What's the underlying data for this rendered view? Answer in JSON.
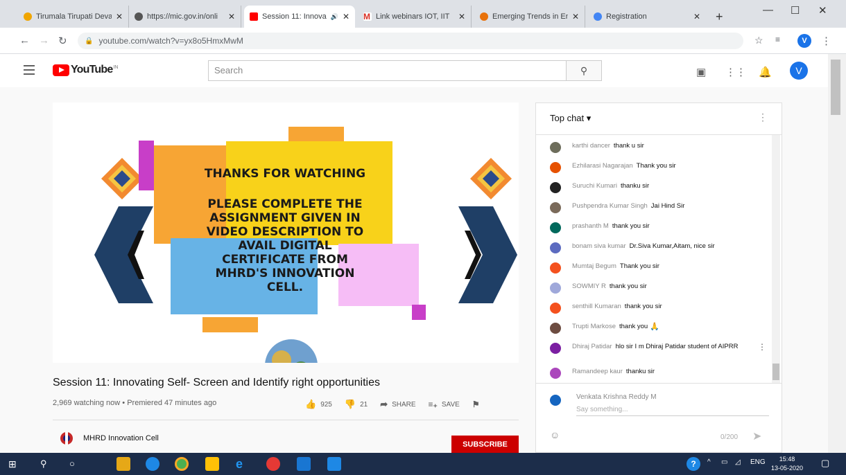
{
  "browser": {
    "tabs": [
      {
        "title": "Tirumala Tirupati Deva",
        "color": "#f0a500"
      },
      {
        "title": "https://mic.gov.in/onli",
        "color": "#555555"
      },
      {
        "title": "Session 11: Innova",
        "color": "#ff0000"
      },
      {
        "title": "Link webinars IOT, IIT",
        "color": "#d93025"
      },
      {
        "title": "Emerging Trends in En",
        "color": "#e8710a"
      },
      {
        "title": "Registration",
        "color": "#4285f4"
      }
    ],
    "url": "youtube.com/watch?v=yx8o5HmxMwM",
    "profile_initial": "V"
  },
  "youtube": {
    "logo_text": "YouTube",
    "logo_region": "IN",
    "search_placeholder": "Search",
    "user_initial": "V"
  },
  "video": {
    "slide_lines": [
      "THANKS FOR WATCHING",
      "PLEASE COMPLETE THE",
      "ASSIGNMENT GIVEN IN",
      "VIDEO DESCRIPTION TO",
      "AVAIL DIGITAL",
      "CERTIFICATE FROM",
      "MHRD'S INNOVATION",
      "CELL."
    ],
    "title": "Session 11: Innovating Self- Screen and Identify right opportunities",
    "meta": "2,969 watching now • Premiered 47 minutes ago",
    "likes": "925",
    "dislikes": "21",
    "share_label": "SHARE",
    "save_label": "SAVE",
    "channel_name": "MHRD Innovation Cell",
    "subscribe_label": "SUBSCRIBE"
  },
  "chat": {
    "header": "Top chat",
    "messages": [
      {
        "author": "karthi dancer",
        "text": "thank u sir",
        "color": "#6d6d5b"
      },
      {
        "author": "Ezhilarasi Nagarajan",
        "text": "Thank you sir",
        "color": "#e65100"
      },
      {
        "author": "Suruchi Kumari",
        "text": "thanku sir",
        "color": "#222222"
      },
      {
        "author": "Pushpendra Kumar Singh",
        "text": "Jai Hind Sir",
        "color": "#7a6a5a"
      },
      {
        "author": "prashanth M",
        "text": "thank you sir",
        "color": "#00695c"
      },
      {
        "author": "bonam siva kumar",
        "text": "Dr.Siva Kumar,Aitam, nice sir",
        "color": "#5c6bc0"
      },
      {
        "author": "Mumtaj Begum",
        "text": "Thank you sir",
        "color": "#f4511e"
      },
      {
        "author": "SOWMIY R",
        "text": "thank you sir",
        "color": "#9fa8da"
      },
      {
        "author": "senthill Kumaran",
        "text": "thank you sir",
        "color": "#f4511e"
      },
      {
        "author": "Trupti Markose",
        "text": "thank you",
        "color": "#6d4c41"
      },
      {
        "author": "Dhiraj Patidar",
        "text": "hlo sir I m Dhiraj Patidar student of AIPRR",
        "color": "#7b1fa2"
      },
      {
        "author": "Ramandeep kaur",
        "text": "thanku sir",
        "color": "#ab47bc"
      }
    ],
    "input_name": "Venkata Krishna Reddy M",
    "input_placeholder": "Say something...",
    "counter": "0/200"
  },
  "taskbar": {
    "lang": "ENG",
    "time": "15:48",
    "date": "13-05-2020"
  }
}
